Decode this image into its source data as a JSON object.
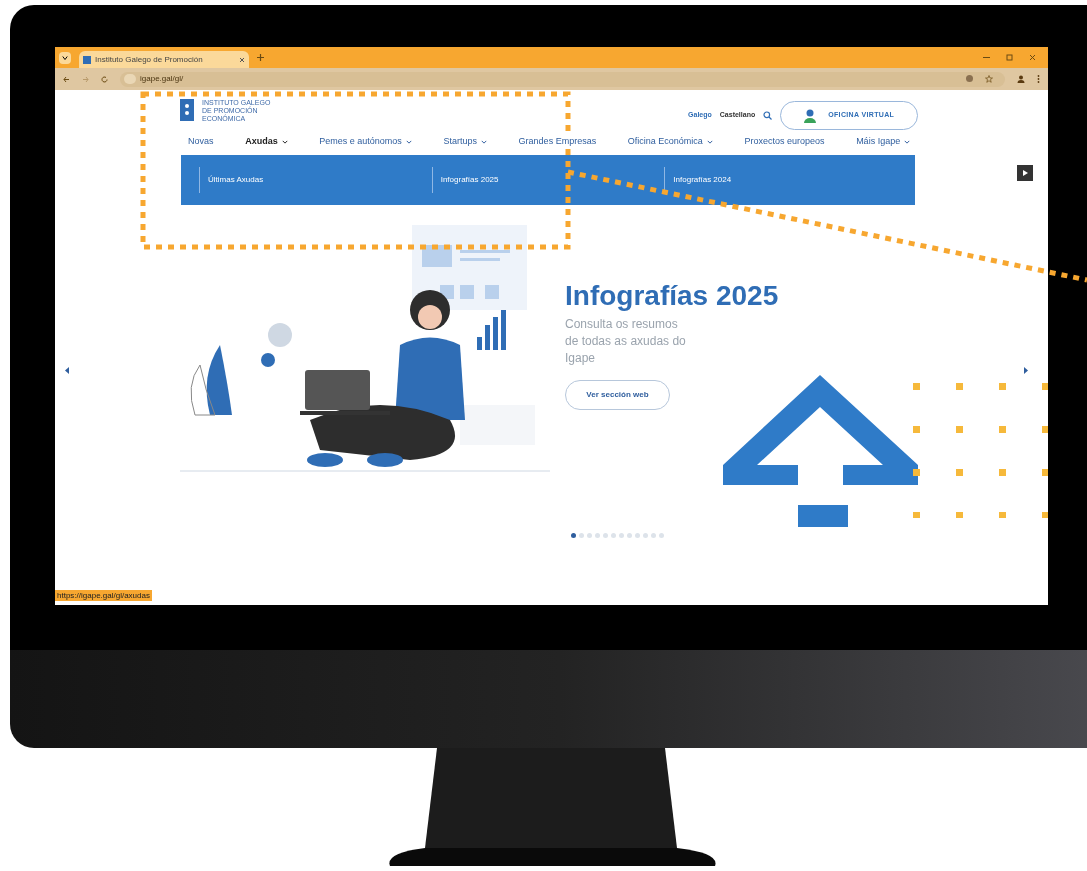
{
  "browser": {
    "tab_title": "Instituto Galego de Promoción",
    "url": "igape.gal/gl/",
    "status_url": "https://igape.gal/gl/axudas"
  },
  "header": {
    "logo_lines": [
      "INSTITUTO GALEGO",
      "DE PROMOCIÓN",
      "ECONÓMICA"
    ],
    "languages": [
      {
        "label": "Galego",
        "selected": true
      },
      {
        "label": "Castellano",
        "selected": false
      }
    ],
    "portal_button": "OFICINA VIRTUAL"
  },
  "nav": [
    {
      "label": "Novas",
      "dropdown": false,
      "selected": false
    },
    {
      "label": "Axudas",
      "dropdown": true,
      "selected": true
    },
    {
      "label": "Pemes e autónomos",
      "dropdown": true,
      "selected": false
    },
    {
      "label": "Startups",
      "dropdown": true,
      "selected": false
    },
    {
      "label": "Grandes Empresas",
      "dropdown": false,
      "selected": false
    },
    {
      "label": "Oficina Económica",
      "dropdown": true,
      "selected": false
    },
    {
      "label": "Proxectos europeos",
      "dropdown": false,
      "selected": false
    },
    {
      "label": "Máis Igape",
      "dropdown": true,
      "selected": false
    }
  ],
  "submenu": [
    "Últimas Axudas",
    "Infografías 2025",
    "Infografías 2024"
  ],
  "hero": {
    "title": "Infografías 2025",
    "text": "Consulta os resumos de todas as axudas do Igape",
    "button": "Ver sección web"
  },
  "carousel_dots": [
    {
      "selected": true
    },
    {
      "selected": false
    },
    {
      "selected": false
    },
    {
      "selected": false
    },
    {
      "selected": false
    },
    {
      "selected": false
    },
    {
      "selected": false
    },
    {
      "selected": false
    },
    {
      "selected": false
    },
    {
      "selected": false
    },
    {
      "selected": false
    },
    {
      "selected": false
    }
  ]
}
